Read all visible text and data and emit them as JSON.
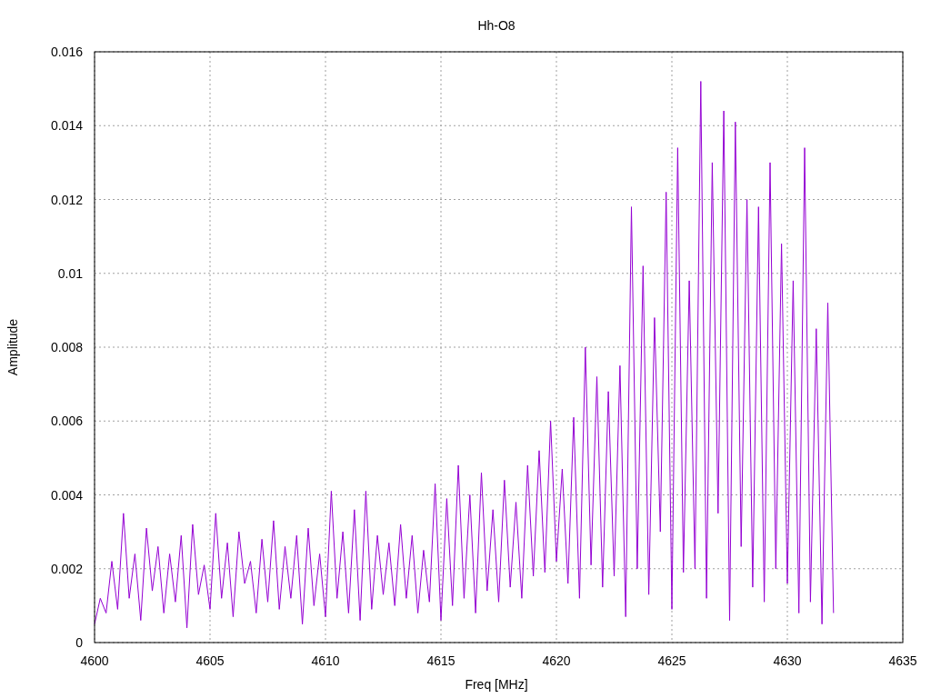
{
  "chart": {
    "chart_data": {
      "type": "line",
      "grid": true,
      "title": "Hh-O8",
      "xlabel": "Freq [MHz]",
      "ylabel": "Amplitude",
      "xlim": [
        4600,
        4635
      ],
      "ylim": [
        0,
        0.016
      ],
      "xticks": [
        4600,
        4605,
        4610,
        4615,
        4620,
        4625,
        4630,
        4635
      ],
      "yticks": [
        0,
        0.002,
        0.004,
        0.006,
        0.008,
        0.01,
        0.012,
        0.014,
        0.016
      ],
      "x": [
        4600,
        4600.25,
        4600.5,
        4600.75,
        4601,
        4601.25,
        4601.5,
        4601.75,
        4602,
        4602.25,
        4602.5,
        4602.75,
        4603,
        4603.25,
        4603.5,
        4603.75,
        4604,
        4604.25,
        4604.5,
        4604.75,
        4605,
        4605.25,
        4605.5,
        4605.75,
        4606,
        4606.25,
        4606.5,
        4606.75,
        4607,
        4607.25,
        4607.5,
        4607.75,
        4608,
        4608.25,
        4608.5,
        4608.75,
        4609,
        4609.25,
        4609.5,
        4609.75,
        4610,
        4610.25,
        4610.5,
        4610.75,
        4611,
        4611.25,
        4611.5,
        4611.75,
        4612,
        4612.25,
        4612.5,
        4612.75,
        4613,
        4613.25,
        4613.5,
        4613.75,
        4614,
        4614.25,
        4614.5,
        4614.75,
        4615,
        4615.25,
        4615.5,
        4615.75,
        4616,
        4616.25,
        4616.5,
        4616.75,
        4617,
        4617.25,
        4617.5,
        4617.75,
        4618,
        4618.25,
        4618.5,
        4618.75,
        4619,
        4619.25,
        4619.5,
        4619.75,
        4620,
        4620.25,
        4620.5,
        4620.75,
        4621,
        4621.25,
        4621.5,
        4621.75,
        4622,
        4622.25,
        4622.5,
        4622.75,
        4623,
        4623.25,
        4623.5,
        4623.75,
        4624,
        4624.25,
        4624.5,
        4624.75,
        4625,
        4625.25,
        4625.5,
        4625.75,
        4626,
        4626.25,
        4626.5,
        4626.75,
        4627,
        4627.25,
        4627.5,
        4627.75,
        4628,
        4628.25,
        4628.5,
        4628.75,
        4629,
        4629.25,
        4629.5,
        4629.75,
        4630,
        4630.25,
        4630.5,
        4630.75,
        4631,
        4631.25,
        4631.5,
        4631.75,
        4632
      ],
      "series": [
        {
          "color": "#9400d3",
          "values": [
            0.0005,
            0.0012,
            0.0008,
            0.0022,
            0.0009,
            0.0035,
            0.0012,
            0.0024,
            0.0006,
            0.0031,
            0.0014,
            0.0026,
            0.0008,
            0.0024,
            0.0011,
            0.0029,
            0.0004,
            0.0032,
            0.0013,
            0.0021,
            0.0009,
            0.0035,
            0.0012,
            0.0027,
            0.0007,
            0.003,
            0.0016,
            0.0022,
            0.0008,
            0.0028,
            0.0011,
            0.0033,
            0.0009,
            0.0026,
            0.0012,
            0.0029,
            0.0005,
            0.0031,
            0.001,
            0.0024,
            0.0007,
            0.0041,
            0.0012,
            0.003,
            0.0008,
            0.0036,
            0.0006,
            0.0041,
            0.0009,
            0.0029,
            0.0013,
            0.0027,
            0.001,
            0.0032,
            0.0012,
            0.0029,
            0.0008,
            0.0025,
            0.0011,
            0.0043,
            0.0006,
            0.0039,
            0.001,
            0.0048,
            0.0012,
            0.004,
            0.0008,
            0.0046,
            0.0014,
            0.0036,
            0.0011,
            0.0044,
            0.0015,
            0.0038,
            0.0012,
            0.0048,
            0.0018,
            0.0052,
            0.0019,
            0.006,
            0.0022,
            0.0047,
            0.0016,
            0.0061,
            0.0012,
            0.008,
            0.0021,
            0.0072,
            0.0015,
            0.0068,
            0.0018,
            0.0075,
            0.0007,
            0.0118,
            0.002,
            0.0102,
            0.0013,
            0.0088,
            0.003,
            0.0122,
            0.0009,
            0.0134,
            0.0019,
            0.0098,
            0.002,
            0.0152,
            0.0012,
            0.013,
            0.0035,
            0.0144,
            0.0006,
            0.0141,
            0.0026,
            0.012,
            0.0015,
            0.0118,
            0.0011,
            0.013,
            0.002,
            0.0108,
            0.0016,
            0.0098,
            0.0008,
            0.0134,
            0.0011,
            0.0085,
            0.0005,
            0.0092,
            0.0008
          ]
        }
      ]
    }
  }
}
